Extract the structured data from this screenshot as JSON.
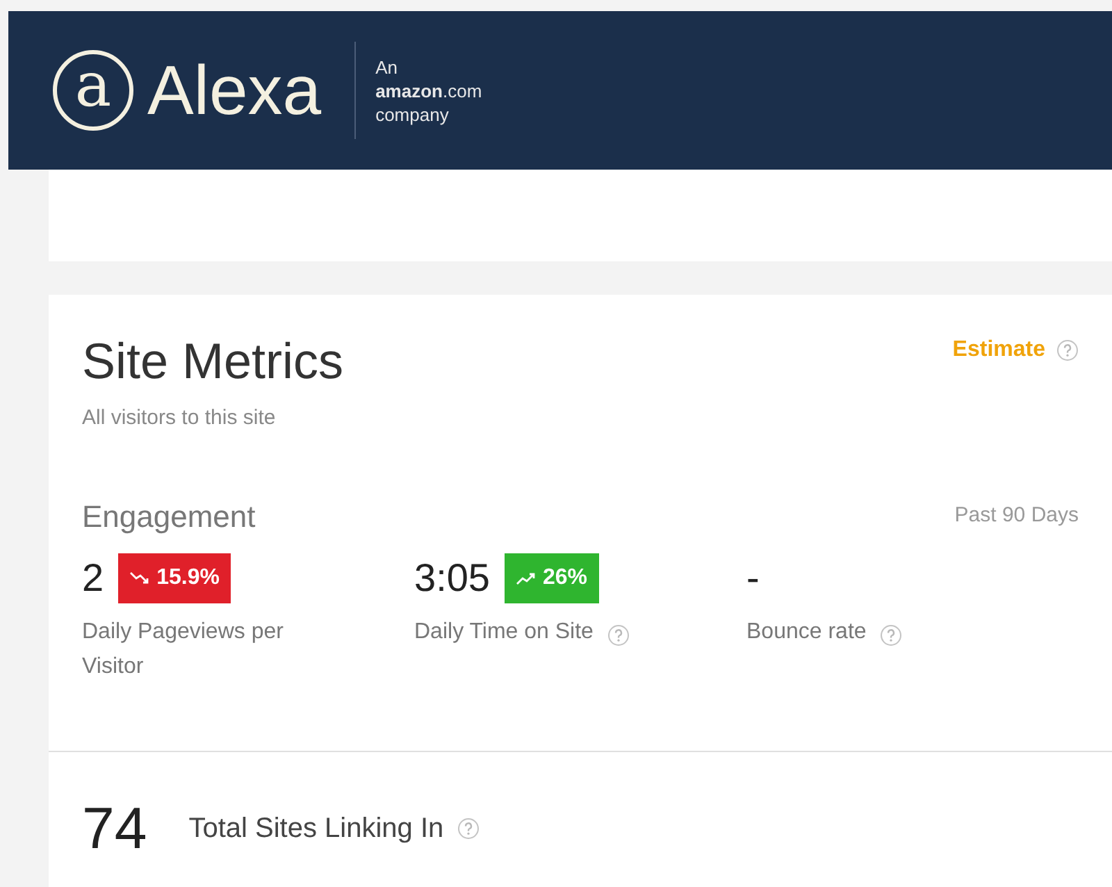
{
  "header": {
    "logo_mark": "a",
    "logo_text": "Alexa",
    "tagline_top": "An",
    "tagline_brand": "**amazon**.com",
    "tagline_bottom": "company"
  },
  "site_metrics": {
    "title": "Site Metrics",
    "subtitle": "All visitors to this site",
    "estimate": "Estimate",
    "section": "Engagement",
    "period": "Past 90 Days",
    "metrics": [
      {
        "value": "2",
        "label": "Daily Pageviews per Visitor",
        "help": false,
        "change": {
          "kind": "down",
          "text": "15.9%"
        }
      },
      {
        "value": "3:05",
        "label": "Daily Time on Site",
        "help": true,
        "change": {
          "kind": "up",
          "text": "26%"
        }
      },
      {
        "value": "-",
        "label": "Bounce rate",
        "help": true
      }
    ]
  },
  "linking": {
    "value": "74",
    "label": "Total Sites Linking In"
  }
}
